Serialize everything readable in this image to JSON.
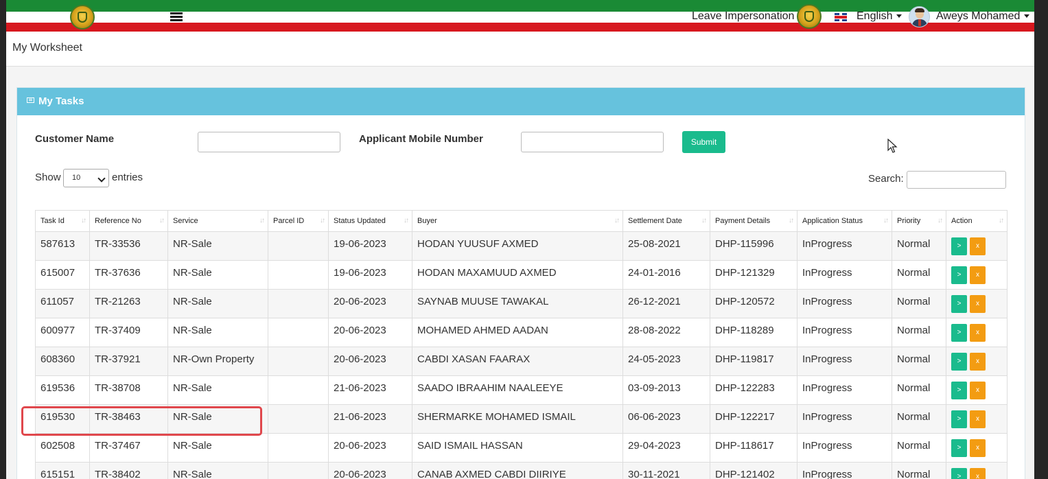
{
  "header": {
    "leave_impersonation": "Leave Impersonation",
    "language": "English",
    "user_name": "Aweys Mohamed"
  },
  "page": {
    "title": "My Worksheet"
  },
  "card": {
    "title": "My Tasks"
  },
  "filters": {
    "customer_name_label": "Customer Name",
    "customer_name_value": "",
    "mobile_label": "Applicant Mobile Number",
    "mobile_value": "",
    "submit_label": "Submit"
  },
  "list_controls": {
    "show_label": "Show",
    "entries_value": "10",
    "entries_label": "entries",
    "search_label": "Search:",
    "search_value": ""
  },
  "table": {
    "columns": [
      "Task Id",
      "Reference No",
      "Service",
      "Parcel ID",
      "Status Updated",
      "Buyer",
      "Settlement Date",
      "Payment Details",
      "Application Status",
      "Priority",
      "Action"
    ],
    "rows": [
      [
        "587613",
        "TR-33536",
        "NR-Sale",
        "",
        "19-06-2023",
        "HODAN YUUSUF AXMED",
        "25-08-2021",
        "DHP-115996",
        "InProgress",
        "Normal"
      ],
      [
        "615007",
        "TR-37636",
        "NR-Sale",
        "",
        "19-06-2023",
        "HODAN MAXAMUUD AXMED",
        "24-01-2016",
        "DHP-121329",
        "InProgress",
        "Normal"
      ],
      [
        "611057",
        "TR-21263",
        "NR-Sale",
        "",
        "20-06-2023",
        "SAYNAB MUUSE TAWAKAL",
        "26-12-2021",
        "DHP-120572",
        "InProgress",
        "Normal"
      ],
      [
        "600977",
        "TR-37409",
        "NR-Sale",
        "",
        "20-06-2023",
        "MOHAMED AHMED AADAN",
        "28-08-2022",
        "DHP-118289",
        "InProgress",
        "Normal"
      ],
      [
        "608360",
        "TR-37921",
        "NR-Own Property",
        "",
        "20-06-2023",
        "CABDI XASAN FAARAX",
        "24-05-2023",
        "DHP-119817",
        "InProgress",
        "Normal"
      ],
      [
        "619536",
        "TR-38708",
        "NR-Sale",
        "",
        "21-06-2023",
        "SAADO IBRAAHIM NAALEEYE",
        "03-09-2013",
        "DHP-122283",
        "InProgress",
        "Normal"
      ],
      [
        "619530",
        "TR-38463",
        "NR-Sale",
        "",
        "21-06-2023",
        "SHERMARKE MOHAMED ISMAIL",
        "06-06-2023",
        "DHP-122217",
        "InProgress",
        "Normal"
      ],
      [
        "602508",
        "TR-37467",
        "NR-Sale",
        "",
        "20-06-2023",
        "SAID ISMAIL HASSAN",
        "29-04-2023",
        "DHP-118617",
        "InProgress",
        "Normal"
      ],
      [
        "615151",
        "TR-38402",
        "NR-Sale",
        "",
        "20-06-2023",
        "CANAB AXMED CABDI DIIRIYE",
        "30-11-2021",
        "DHP-121402",
        "InProgress",
        "Normal"
      ]
    ],
    "action_go": ">",
    "action_cancel": "x"
  },
  "icons": {
    "menu": "hamburger-icon",
    "emblem": "emblem-icon",
    "flag": "uk-flag-icon",
    "tasks": "tasks-icon",
    "cursor": "mouse-cursor-icon"
  },
  "colors": {
    "stripe_green": "#1a8a35",
    "stripe_red": "#d7181f",
    "card_header": "#66c2dd",
    "submit": "#1abb8d",
    "action_go": "#1abb8d",
    "action_cancel": "#f39c12",
    "highlight": "#e0474c"
  }
}
